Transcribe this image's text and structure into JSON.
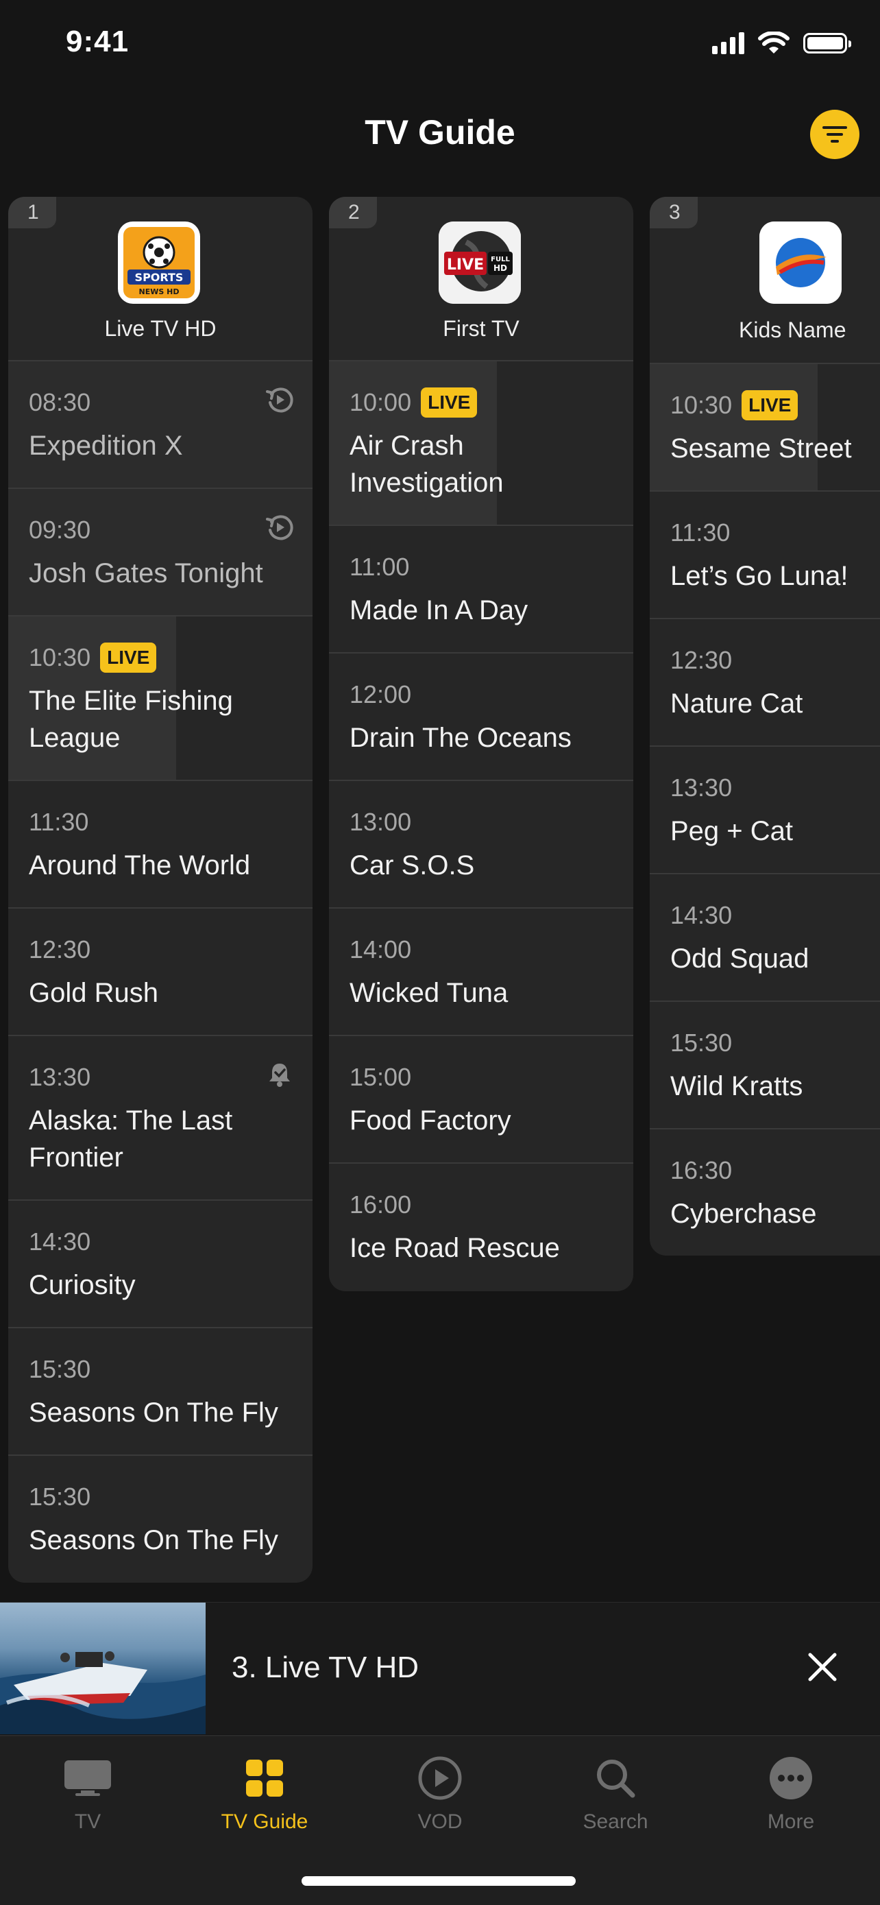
{
  "status_bar": {
    "time": "9:41"
  },
  "header": {
    "title": "TV Guide"
  },
  "colors": {
    "accent": "#F6C21B",
    "background": "#151515",
    "card": "#262626"
  },
  "channels": [
    {
      "number": "1",
      "name": "Live TV HD",
      "logo": "sports-news-logo",
      "logo_text": "SPORTS NEWS HD",
      "programs": [
        {
          "time": "08:30",
          "title": "Expedition X",
          "icon": "replay-icon"
        },
        {
          "time": "09:30",
          "title": "Josh Gates Tonight",
          "icon": "replay-icon"
        },
        {
          "time": "10:30",
          "title": "The Elite Fishing League",
          "badge": "LIVE"
        },
        {
          "time": "11:30",
          "title": "Around The World"
        },
        {
          "time": "12:30",
          "title": "Gold Rush"
        },
        {
          "time": "13:30",
          "title": "Alaska: The Last Frontier",
          "icon": "reminder-bell-icon"
        },
        {
          "time": "14:30",
          "title": "Curiosity"
        },
        {
          "time": "15:30",
          "title": "Seasons On The Fly"
        },
        {
          "time": "15:30",
          "title": "Seasons On The Fly"
        }
      ]
    },
    {
      "number": "2",
      "name": "First TV",
      "logo": "live-full-hd-logo",
      "logo_text": "LIVE FULL HD",
      "programs": [
        {
          "time": "10:00",
          "title": "Air Crash Investigation",
          "badge": "LIVE"
        },
        {
          "time": "11:00",
          "title": "Made In A Day"
        },
        {
          "time": "12:00",
          "title": "Drain The Oceans"
        },
        {
          "time": "13:00",
          "title": "Car S.O.S"
        },
        {
          "time": "14:00",
          "title": "Wicked Tuna"
        },
        {
          "time": "15:00",
          "title": "Food Factory"
        },
        {
          "time": "16:00",
          "title": "Ice Road Rescue"
        }
      ]
    },
    {
      "number": "3",
      "name": "Kids Name",
      "logo": "swoosh-globe-logo",
      "programs": [
        {
          "time": "10:30",
          "title": "Sesame Street",
          "badge": "LIVE"
        },
        {
          "time": "11:30",
          "title": "Let’s Go Luna!"
        },
        {
          "time": "12:30",
          "title": "Nature Cat"
        },
        {
          "time": "13:30",
          "title": "Peg + Cat"
        },
        {
          "time": "14:30",
          "title": "Odd Squad"
        },
        {
          "time": "15:30",
          "title": "Wild Kratts"
        },
        {
          "time": "16:30",
          "title": "Cyberchase"
        }
      ]
    }
  ],
  "now_playing": {
    "title": "3. Live TV HD"
  },
  "tabbar": [
    {
      "label": "TV",
      "icon": "tv-icon"
    },
    {
      "label": "TV Guide",
      "icon": "grid-icon",
      "active": true
    },
    {
      "label": "VOD",
      "icon": "play-circle-icon"
    },
    {
      "label": "Search",
      "icon": "search-icon"
    },
    {
      "label": "More",
      "icon": "more-icon"
    }
  ]
}
